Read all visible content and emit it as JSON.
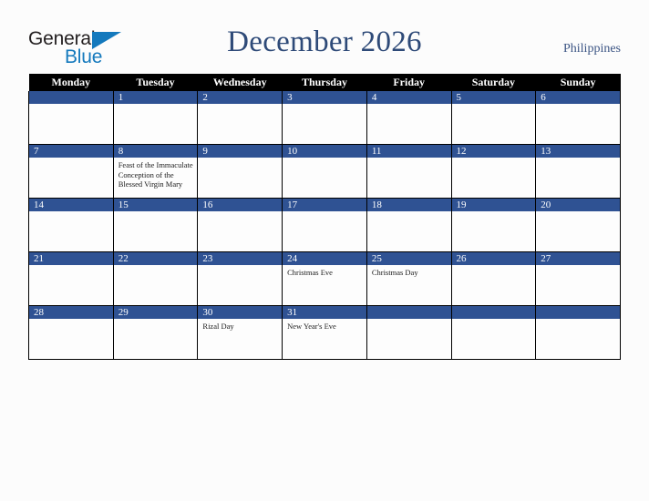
{
  "brand": {
    "word_top": "General",
    "word_bottom": "Blue",
    "triangle_icon": "triangle-logo-icon",
    "color_dark": "#231f20",
    "color_blue": "#1479bd"
  },
  "header": {
    "title": "December 2026",
    "country": "Philippines",
    "title_color": "#2e4a78",
    "country_color": "#3c5584"
  },
  "calendar": {
    "header_bg": "#000000",
    "day_bar_bg": "#2f5293",
    "weekday_headers": [
      "Monday",
      "Tuesday",
      "Wednesday",
      "Thursday",
      "Friday",
      "Saturday",
      "Sunday"
    ],
    "weeks": [
      [
        {
          "number": "",
          "events": []
        },
        {
          "number": "1",
          "events": []
        },
        {
          "number": "2",
          "events": []
        },
        {
          "number": "3",
          "events": []
        },
        {
          "number": "4",
          "events": []
        },
        {
          "number": "5",
          "events": []
        },
        {
          "number": "6",
          "events": []
        }
      ],
      [
        {
          "number": "7",
          "events": []
        },
        {
          "number": "8",
          "events": [
            "Feast of the Immaculate Conception of the Blessed Virgin Mary"
          ]
        },
        {
          "number": "9",
          "events": []
        },
        {
          "number": "10",
          "events": []
        },
        {
          "number": "11",
          "events": []
        },
        {
          "number": "12",
          "events": []
        },
        {
          "number": "13",
          "events": []
        }
      ],
      [
        {
          "number": "14",
          "events": []
        },
        {
          "number": "15",
          "events": []
        },
        {
          "number": "16",
          "events": []
        },
        {
          "number": "17",
          "events": []
        },
        {
          "number": "18",
          "events": []
        },
        {
          "number": "19",
          "events": []
        },
        {
          "number": "20",
          "events": []
        }
      ],
      [
        {
          "number": "21",
          "events": []
        },
        {
          "number": "22",
          "events": []
        },
        {
          "number": "23",
          "events": []
        },
        {
          "number": "24",
          "events": [
            "Christmas Eve"
          ]
        },
        {
          "number": "25",
          "events": [
            "Christmas Day"
          ]
        },
        {
          "number": "26",
          "events": []
        },
        {
          "number": "27",
          "events": []
        }
      ],
      [
        {
          "number": "28",
          "events": []
        },
        {
          "number": "29",
          "events": []
        },
        {
          "number": "30",
          "events": [
            "Rizal Day"
          ]
        },
        {
          "number": "31",
          "events": [
            "New Year's Eve"
          ]
        },
        {
          "number": "",
          "events": []
        },
        {
          "number": "",
          "events": []
        },
        {
          "number": "",
          "events": []
        }
      ]
    ]
  }
}
